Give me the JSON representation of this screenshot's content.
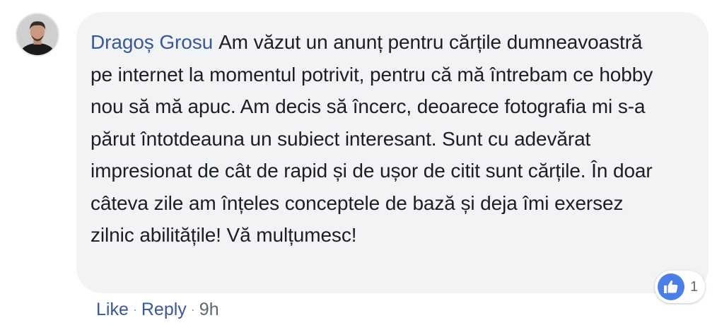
{
  "comment": {
    "author": "Dragoș Grosu",
    "text": "Am văzut un anunț pentru cărțile dumneavoastră pe internet la momentul potrivit, pentru că mă întrebam ce hobby nou să mă apuc. Am decis să încerc, deoarece fotografia mi s-a părut întotdeauna un subiect interesant. Sunt cu adevărat impresionat de cât de rapid și de ușor de citit sunt cărțile. În doar câteva zile am înțeles conceptele de bază și deja îmi exersez zilnic abilitățile! Vă mulțumesc!",
    "reaction_count": "1"
  },
  "actions": {
    "like_label": "Like",
    "reply_label": "Reply",
    "separator": "·",
    "time": "9h"
  },
  "colors": {
    "author": "#385898",
    "bubble_bg": "#f2f3f5",
    "like_badge": "#4a7fe8"
  },
  "icons": {
    "reaction": "thumbs-up-icon"
  }
}
